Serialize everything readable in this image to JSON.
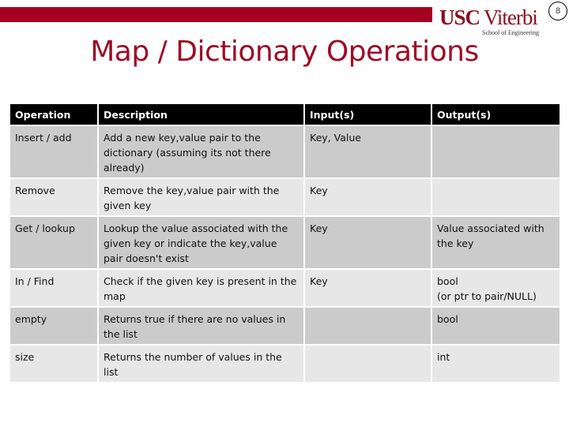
{
  "header": {
    "accent_color": "#A50021",
    "logo": {
      "usc": "USC",
      "viterbi": "Viterbi",
      "school": "School of Engineering"
    },
    "page_number": "8"
  },
  "title": "Map / Dictionary Operations",
  "table": {
    "columns": [
      "Operation",
      "Description",
      "Input(s)",
      "Output(s)"
    ],
    "rows": [
      {
        "operation": "Insert / add",
        "description": "Add a new key,value pair to the dictionary (assuming its not there already)",
        "inputs": "Key, Value",
        "outputs": [
          "",
          ""
        ]
      },
      {
        "operation": "Remove",
        "description": "Remove the key,value pair with the given key",
        "inputs": "Key",
        "outputs": [
          "",
          ""
        ]
      },
      {
        "operation": "Get / lookup",
        "description": "Lookup the value associated with the given key or indicate the key,value pair doesn't exist",
        "inputs": "Key",
        "outputs": [
          "Value associated with the key",
          ""
        ]
      },
      {
        "operation": "In / Find",
        "description": "Check if the given key is present in the map",
        "inputs": "Key",
        "outputs": [
          "bool",
          "(or ptr to pair/NULL)"
        ]
      },
      {
        "operation": "empty",
        "description": "Returns true if there are no values in the list",
        "inputs": "",
        "outputs": [
          "bool",
          ""
        ]
      },
      {
        "operation": "size",
        "description": "Returns the number of values in the list",
        "inputs": "",
        "outputs": [
          "int",
          ""
        ]
      }
    ]
  }
}
